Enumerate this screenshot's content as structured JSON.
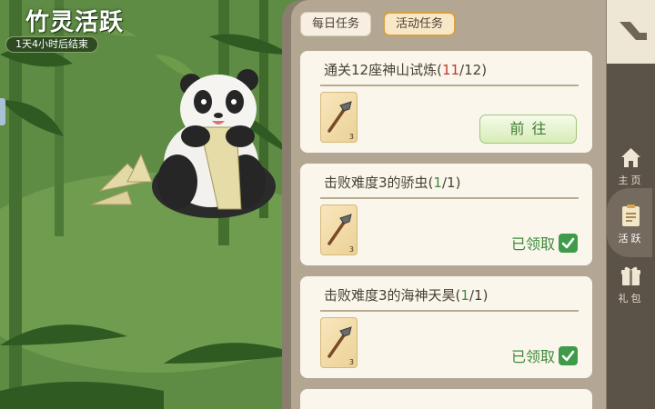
{
  "event": {
    "title": "竹灵活跃",
    "timer": "1天4小时后结束"
  },
  "tabs": [
    {
      "label": "每日任务",
      "active": false
    },
    {
      "label": "活动任务",
      "active": true
    }
  ],
  "tasks": [
    {
      "name": "通关12座神山试炼",
      "current": "11",
      "total": "12",
      "item_count": "3",
      "action": "前往",
      "status": "in-progress"
    },
    {
      "name": "击败难度3的骄虫",
      "current": "1",
      "total": "1",
      "item_count": "3",
      "action": "已领取",
      "status": "claimed"
    },
    {
      "name": "击败难度3的海神天昊",
      "current": "1",
      "total": "1",
      "item_count": "3",
      "action": "已领取",
      "status": "claimed"
    }
  ],
  "nav": {
    "items": [
      {
        "label": "主页",
        "icon": "home-icon",
        "active": false
      },
      {
        "label": "活跃",
        "icon": "task-list-icon",
        "active": true
      },
      {
        "label": "礼包",
        "icon": "gift-icon",
        "active": false
      }
    ]
  },
  "colors": {
    "progress_incomplete": "#c0392b",
    "progress_complete": "#3f8a3a",
    "tab_active_border": "#d7a043",
    "claimed_green": "#3f9b4a"
  }
}
